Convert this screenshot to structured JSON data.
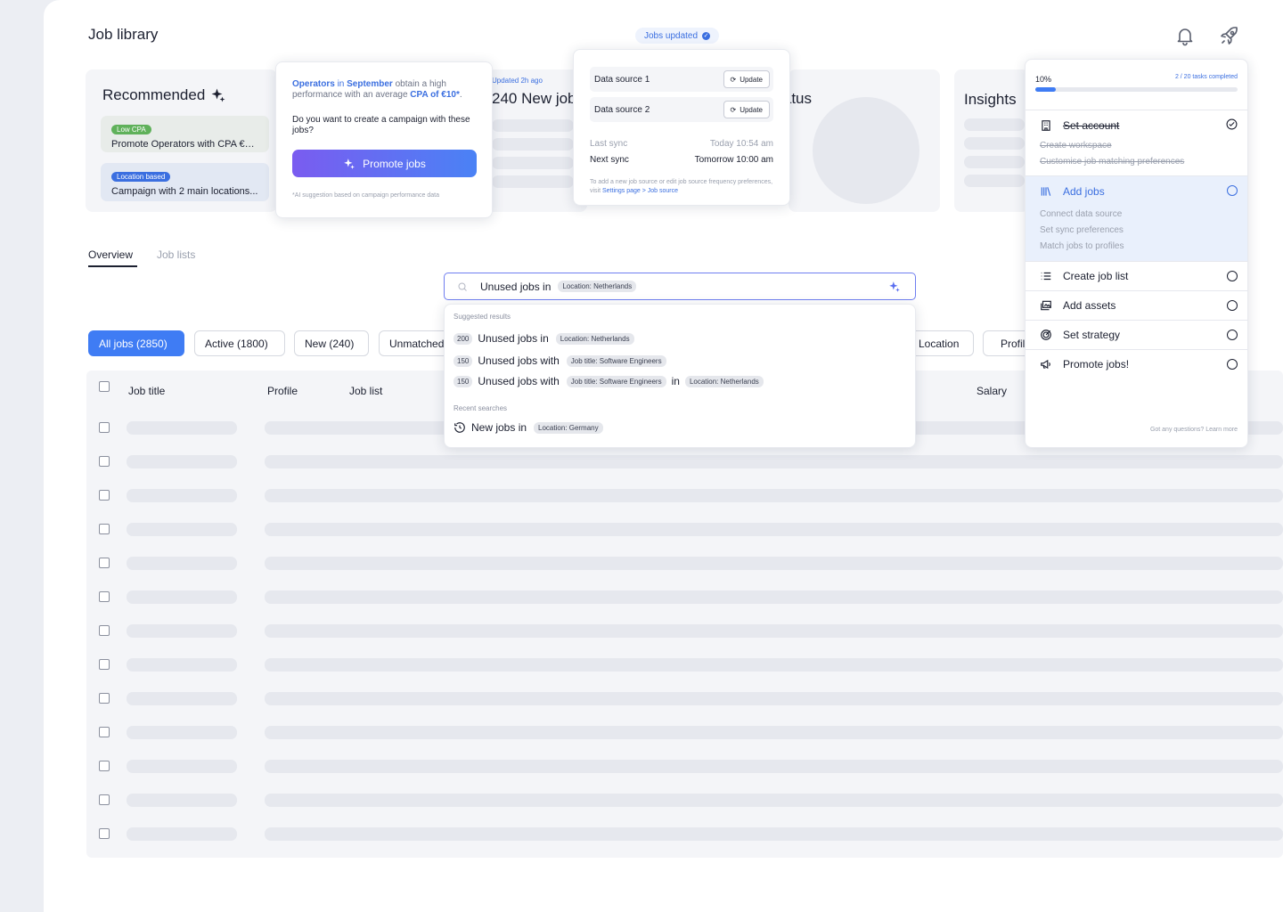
{
  "header": {
    "title": "Job library",
    "jobs_updated": "Jobs updated"
  },
  "recommended": {
    "title": "Recommended",
    "items": [
      {
        "badge": "Low CPA",
        "text": "Promote Operators with CPA €10...",
        "badge_color": "#5fb15a",
        "bg": "#e8ece9"
      },
      {
        "badge": "Location based",
        "text": "Campaign with 2 main locations...",
        "badge_color": "#3b6fe0",
        "bg": "#e2e8f3"
      }
    ]
  },
  "cards": {
    "new_jobs_updated": "Updated 2h ago",
    "new_jobs_title": "240 New jobs",
    "status_title": "Status",
    "insights_title": "Insights"
  },
  "promo_popup": {
    "part1": "Operators",
    "part2": " in ",
    "part3": "September",
    "part4": " obtain a high performance with an average ",
    "part5": "CPA of €10*",
    "part6": ".",
    "question": "Do you want to create a campaign with these jobs?",
    "button": "Promote jobs",
    "footnote": "*AI suggestion based on campaign performance data"
  },
  "sync_popup": {
    "sources": [
      {
        "name": "Data source 1",
        "button": "Update"
      },
      {
        "name": "Data source 2",
        "button": "Update"
      }
    ],
    "last_sync_label": "Last sync",
    "last_sync_value": "Today 10:54 am",
    "next_sync_label": "Next sync",
    "next_sync_value": "Tomorrow 10:00 am",
    "note": "To add a new job source or edit job source frequency preferences, visit ",
    "link": "Settings page > Job source"
  },
  "tabs": [
    {
      "label": "Overview",
      "active": true
    },
    {
      "label": "Job lists",
      "active": false
    }
  ],
  "search": {
    "query": "Unused jobs in",
    "chip": "Location: Netherlands"
  },
  "suggestions": {
    "suggested_label": "Suggested results",
    "items": [
      {
        "count": "200",
        "text": "Unused jobs in",
        "chip1": "Location: Netherlands",
        "mid": "",
        "chip2": ""
      },
      {
        "count": "150",
        "text": "Unused jobs with",
        "chip1": "Job title: Software Engineers",
        "mid": "",
        "chip2": ""
      },
      {
        "count": "150",
        "text": "Unused jobs with",
        "chip1": "Job title: Software Engineers",
        "mid": "in",
        "chip2": "Location: Netherlands"
      }
    ],
    "recent_label": "Recent searches",
    "recent": [
      {
        "text": "New jobs in",
        "chip": "Location: Germany"
      }
    ]
  },
  "filters": [
    {
      "label": "All jobs (2850)",
      "active": true
    },
    {
      "label": "Active (1800)",
      "active": false
    },
    {
      "label": "New (240)",
      "active": false
    },
    {
      "label": "Unmatched",
      "active": false
    },
    {
      "label": "Location",
      "active": false
    },
    {
      "label": "Profile",
      "active": false
    }
  ],
  "table": {
    "columns": [
      "Job title",
      "Profile",
      "Job list",
      "Salary"
    ]
  },
  "checklist": {
    "progress_percent": "10%",
    "progress_value": 0.1,
    "tasks_completed": "2 / 20 tasks completed",
    "items": [
      {
        "label": "Set account",
        "done": true,
        "subs": [
          "Create workspace",
          "Customise job matching preferences"
        ]
      },
      {
        "label": "Add jobs",
        "done": false,
        "active": true,
        "subs": [
          "Connect data source",
          "Set sync preferences",
          "Match jobs to profiles"
        ]
      },
      {
        "label": "Create job list",
        "done": false,
        "subs": []
      },
      {
        "label": "Add assets",
        "done": false,
        "subs": []
      },
      {
        "label": "Set strategy",
        "done": false,
        "subs": []
      },
      {
        "label": "Promote jobs!",
        "done": false,
        "subs": []
      }
    ],
    "footer": "Got any questions? Learn more"
  },
  "icons": {
    "bell": "bell-icon",
    "rocket": "rocket-icon",
    "sparkle": "sparkle-icon",
    "search": "search-icon",
    "history": "history-icon",
    "refresh": "refresh-icon",
    "accent": "#3f7cf4"
  }
}
